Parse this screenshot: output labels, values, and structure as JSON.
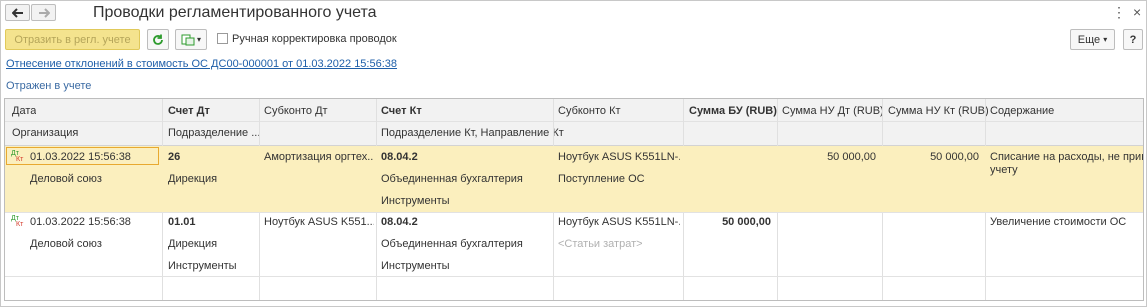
{
  "header": {
    "title": "Проводки регламентированного учета"
  },
  "toolbar": {
    "post_label": "Отразить в регл. учете",
    "manual_label": "Ручная корректировка проводок",
    "more_label": "Еще",
    "help_label": "?"
  },
  "doc_link": "Отнесение отклонений в стоимость ОС ДС00-000001 от 01.03.2022 15:56:38",
  "status_text": "Отражен в учете",
  "table": {
    "headers_top": [
      "Дата",
      "Счет Дт",
      "Субконто Дт",
      "Счет Кт",
      "Субконто Кт",
      "Сумма БУ (RUB)",
      "Сумма НУ Дт (RUB)",
      "Сумма НУ Кт (RUB)",
      "Содержание"
    ],
    "headers_bottom": [
      "Организация",
      "Подразделение ...",
      "Подразделение Кт, Направление Кт"
    ],
    "rows": [
      {
        "date": "01.03.2022 15:56:38",
        "org": "Деловой союз",
        "acc_dt": "26",
        "dept_dt": "Дирекция",
        "sub_dt": "Амортизация оргтех...",
        "acc_kt": "08.04.2",
        "dept_kt": "Объединенная бухгалтерия",
        "dir_kt": "Инструменты",
        "sub_kt": "Ноутбук ASUS K551LN-...",
        "sub_kt2": "Поступление ОС",
        "sum_bu": "",
        "sum_nu_dt": "50 000,00",
        "sum_nu_kt": "50 000,00",
        "content": "Списание на расходы, не принима",
        "content2": "учету"
      },
      {
        "date": "01.03.2022 15:56:38",
        "org": "Деловой союз",
        "acc_dt": "01.01",
        "dept_dt": "Дирекция",
        "dir_dt": "Инструменты",
        "sub_dt": "Ноутбук ASUS K551...",
        "acc_kt": "08.04.2",
        "dept_kt": "Объединенная бухгалтерия",
        "dir_kt": "Инструменты",
        "sub_kt": "Ноутбук ASUS K551LN-...",
        "sub_kt2": "<Статьи затрат>",
        "sum_bu": "50 000,00",
        "sum_nu_dt": "",
        "sum_nu_kt": "",
        "content": "Увеличение стоимости ОС"
      }
    ],
    "entry_icon": {
      "dt": "Дт",
      "kt": "Кт"
    }
  }
}
